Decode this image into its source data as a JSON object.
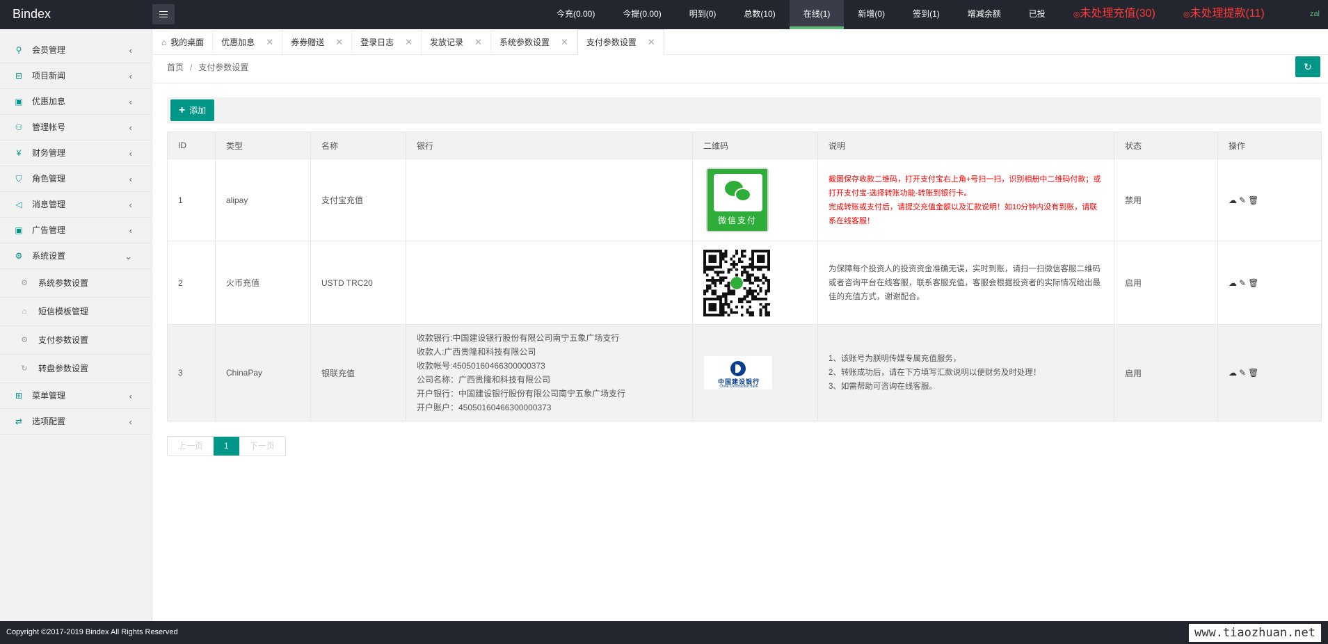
{
  "app": {
    "logo": "Bindex",
    "user": "zal"
  },
  "topnav": [
    {
      "label": "今充(0.00)"
    },
    {
      "label": "今提(0.00)"
    },
    {
      "label": "明到(0)"
    },
    {
      "label": "总数(10)"
    },
    {
      "label": "在线(1)"
    },
    {
      "label": "新增(0)"
    },
    {
      "label": "签到(1)"
    },
    {
      "label": "增减余额"
    },
    {
      "label": "已投"
    },
    {
      "label": "未处理充值(30)"
    },
    {
      "label": "未处理提款(11)"
    }
  ],
  "sidebar": {
    "items": [
      {
        "label": "会员管理",
        "icon": "user-icon"
      },
      {
        "label": "项目新闻",
        "icon": "book-icon"
      },
      {
        "label": "优惠加息",
        "icon": "picture-icon"
      },
      {
        "label": "管理帐号",
        "icon": "account-icon"
      },
      {
        "label": "财务管理",
        "icon": "yen-icon"
      },
      {
        "label": "角色管理",
        "icon": "shield-icon"
      },
      {
        "label": "消息管理",
        "icon": "speaker-icon"
      },
      {
        "label": "广告管理",
        "icon": "image-icon"
      },
      {
        "label": "系统设置",
        "icon": "gear-icon"
      }
    ],
    "subitems": [
      {
        "label": "系统参数设置",
        "icon": "gear-icon"
      },
      {
        "label": "短信模板管理",
        "icon": "tag-icon"
      },
      {
        "label": "支付参数设置",
        "icon": "gear-icon"
      },
      {
        "label": "转盘参数设置",
        "icon": "refresh-icon"
      }
    ],
    "items_after": [
      {
        "label": "菜单管理",
        "icon": "grid-icon"
      },
      {
        "label": "选项配置",
        "icon": "swap-icon"
      }
    ]
  },
  "tabs": [
    {
      "label": "我的桌面"
    },
    {
      "label": "优惠加息"
    },
    {
      "label": "券券赠送"
    },
    {
      "label": "登录日志"
    },
    {
      "label": "发放记录"
    },
    {
      "label": "系统参数设置"
    },
    {
      "label": "支付参数设置"
    }
  ],
  "breadcrumb": {
    "home": "首页",
    "sep": "/",
    "current": "支付参数设置"
  },
  "toolbar": {
    "add_label": "添加"
  },
  "table": {
    "headers": [
      "ID",
      "类型",
      "名称",
      "银行",
      "二维码",
      "说明",
      "状态",
      "操作"
    ],
    "rows": [
      {
        "id": "1",
        "type": "alipay",
        "name": "支付宝充值",
        "bank": [],
        "qr_label": "微信支付",
        "desc": [
          "截图保存收款二维码，打开支付宝右上角+号扫一扫，识别相册中二维码付款；或打开支付宝-选择转账功能-转账到银行卡。",
          "完成转账或支付后，请提交充值金额以及汇款说明！如10分钟内没有到账，请联系在线客服！"
        ],
        "status": "禁用"
      },
      {
        "id": "2",
        "type": "火币充值",
        "name": "USTD TRC20",
        "bank": [],
        "desc": [
          "为保障每个投资人的投资资金准确无误，实时到账，请扫一扫微信客服二维码或者咨询平台在线客服，联系客服充值，客服会根据投资者的实际情况给出最佳的充值方式，谢谢配合。"
        ],
        "status": "启用"
      },
      {
        "id": "3",
        "type": "ChinaPay",
        "name": "银联充值",
        "bank": [
          "收款银行:中国建设银行股份有限公司南宁五象广场支行",
          "收款人:广西贵隆和科技有限公司",
          "收款帐号:45050160466300000373",
          "公司名称：广西贵隆和科技有限公司",
          "开户银行：中国建设银行股份有限公司南宁五象广场支行",
          "开户账户：45050160466300000373"
        ],
        "qr_label": "中国建设银行",
        "qr_label_en": "China Construction Bank",
        "desc": [
          "1、该账号为朕明传媒专属充值服务，",
          "2、转账成功后，请在下方填写汇款说明以便财务及时处理！",
          "3、如需帮助可咨询在线客服。"
        ],
        "status": "启用"
      }
    ]
  },
  "pager": {
    "prev": "上一页",
    "current": "1",
    "next": "下一页"
  },
  "footer": {
    "copyright": "Copyright ©2017-2019 Bindex All Rights Reserved",
    "watermark": "www.tiaozhuan.net"
  },
  "colors": {
    "accent": "#009688",
    "header_bg": "#23262e",
    "alert": "#ff3b3b",
    "active_underline": "#5fb878"
  }
}
